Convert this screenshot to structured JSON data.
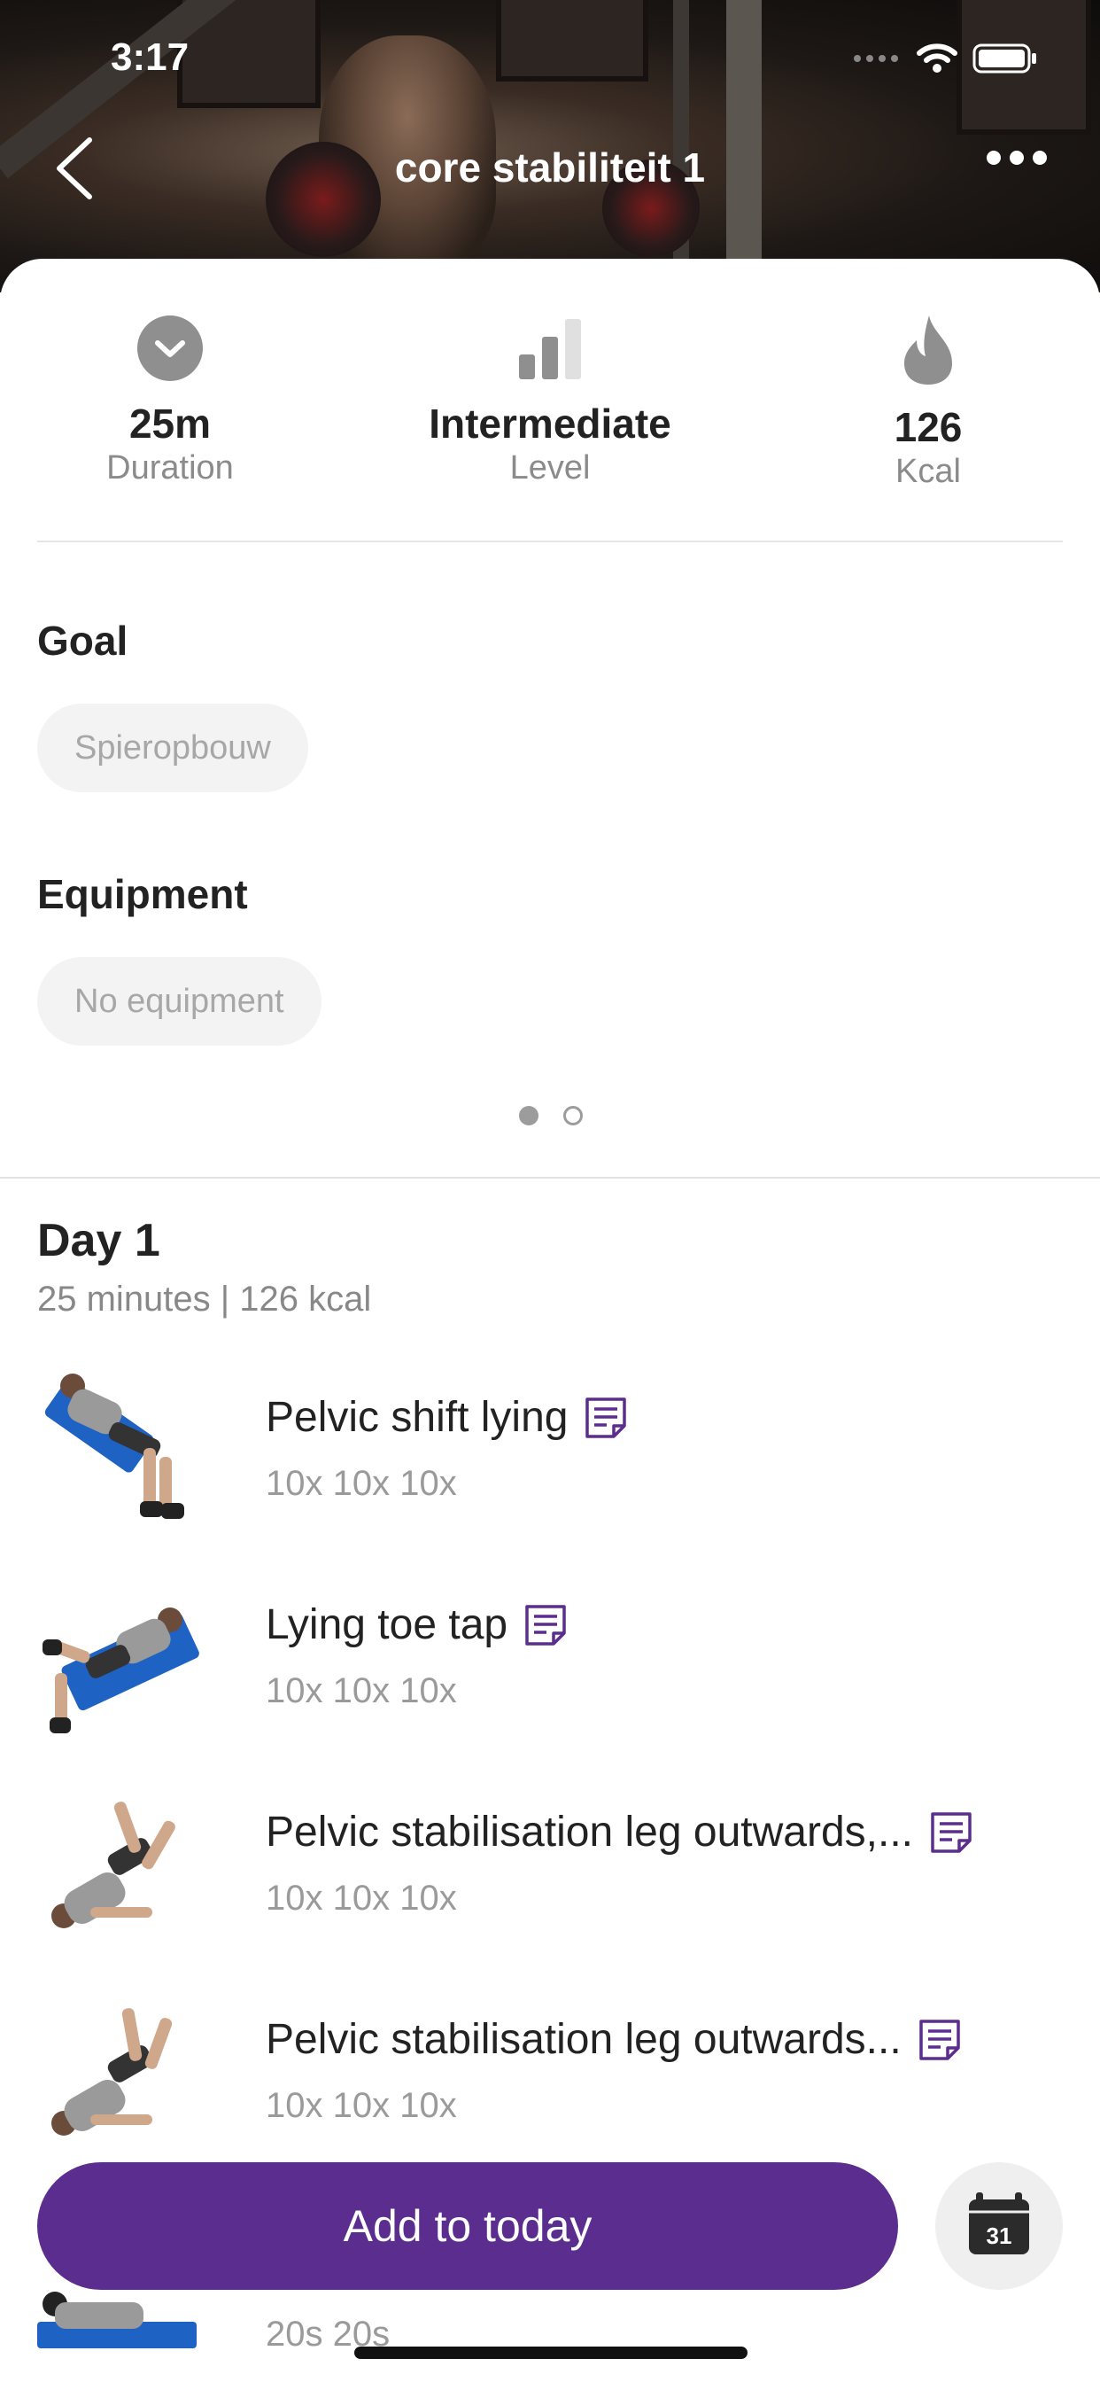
{
  "status_bar": {
    "time": "3:17"
  },
  "header": {
    "title": "core stabiliteit 1",
    "back_icon": "chevron-left-icon",
    "more_icon": "ellipsis-icon"
  },
  "stats": [
    {
      "icon": "clock-chevron-icon",
      "value": "25m",
      "label": "Duration"
    },
    {
      "icon": "signal-bars-icon",
      "value": "Intermediate",
      "label": "Level"
    },
    {
      "icon": "flame-icon",
      "value": "126",
      "label": "Kcal"
    }
  ],
  "goal": {
    "title": "Goal",
    "chip": "Spieropbouw"
  },
  "equipment": {
    "title": "Equipment",
    "chip": "No equipment"
  },
  "pager": {
    "pages": 2,
    "active": 1
  },
  "day": {
    "title": "Day 1",
    "subtitle": "25 minutes | 126 kcal",
    "exercises": [
      {
        "name": "Pelvic shift lying",
        "reps": "10x 10x 10x"
      },
      {
        "name": "Lying toe tap",
        "reps": "10x 10x 10x"
      },
      {
        "name": "Pelvic stabilisation leg outwards,...",
        "reps": "10x 10x 10x"
      },
      {
        "name": "Pelvic stabilisation leg outwards...",
        "reps": "10x 10x 10x"
      },
      {
        "name": "",
        "reps": "20s 20s"
      }
    ]
  },
  "actions": {
    "add_label": "Add to today",
    "calendar_day": "31"
  },
  "colors": {
    "accent": "#5b2d8e",
    "muted_text": "#8b8b8b",
    "chip_bg": "#f3f3f3"
  }
}
